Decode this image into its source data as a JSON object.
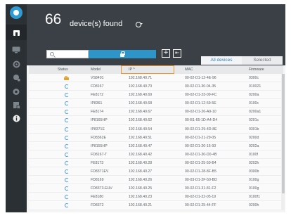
{
  "header": {
    "count": "66",
    "found_label": "device(s) found"
  },
  "toolbar": {
    "search_placeholder": "",
    "add_label": "+",
    "export_label": "⇤"
  },
  "tabs": {
    "all": "All devices",
    "selected": "Selected"
  },
  "columns": {
    "status": "Status",
    "model": "Model",
    "ip": "IP ^",
    "mac": "MAC",
    "firmware": "Firmware"
  },
  "rows": [
    {
      "status": "locked",
      "model": "VS8401",
      "ip": "192.168.40.71",
      "mac": "00-02-D1-12-4E-96",
      "firmware": "0300c"
    },
    {
      "status": "loading",
      "model": "FD8167",
      "ip": "192.168.40.70",
      "mac": "00-02-D1-30-04-35",
      "firmware": "010021"
    },
    {
      "status": "loading",
      "model": "FE8172",
      "ip": "192.168.40.69",
      "mac": "00-02-D1-23-09-FC",
      "firmware": "0200a"
    },
    {
      "status": "loading",
      "model": "IP8361",
      "ip": "192.168.40.68",
      "mac": "00-02-D1-12-59-5E",
      "firmware": "0100c"
    },
    {
      "status": "loading",
      "model": "FE8174",
      "ip": "192.168.40.67",
      "mac": "00-02-D1-26-A9-10",
      "firmware": "0200a1"
    },
    {
      "status": "loading",
      "model": "IP8165HP",
      "ip": "192.168.40.62",
      "mac": "00-B1-65-1D-A4-D4",
      "firmware": "0201c"
    },
    {
      "status": "loading",
      "model": "IP8371E",
      "ip": "192.168.40.54",
      "mac": "00-02-D1-29-4D-8E",
      "firmware": "0301b"
    },
    {
      "status": "loading",
      "model": "FD8362E",
      "ip": "192.168.40.51",
      "mac": "00-02-D1-21-29-05",
      "firmware": "0200d"
    },
    {
      "status": "loading",
      "model": "IP8155HP",
      "ip": "192.168.40.47",
      "mac": "00-02-D1-20-16-93",
      "firmware": "0202a"
    },
    {
      "status": "loading",
      "model": "FD8167-T",
      "ip": "192.168.40.42",
      "mac": "00-02-D1-30-D0-4B",
      "firmware": "0100f"
    },
    {
      "status": "loading",
      "model": "FE8173",
      "ip": "192.168.40.28",
      "mac": "00-02-D1-25-50-B4",
      "firmware": "0202h"
    },
    {
      "status": "loading",
      "model": "FD8371EV",
      "ip": "192.168.40.27",
      "mac": "00-02-D1-28-8F-B5",
      "firmware": "0300b"
    },
    {
      "status": "loading",
      "model": "FD8169",
      "ip": "192.168.40.26",
      "mac": "00-03-D1-2F-50-BD",
      "firmware": "0100g"
    },
    {
      "status": "loading",
      "model": "FD8373-EHV",
      "ip": "192.168.40.25",
      "mac": "00-02-D1-31-81-F2",
      "firmware": "0100g"
    },
    {
      "status": "loading",
      "model": "FE8180",
      "ip": "192.168.40.23",
      "mac": "00-02-D1-32-05-19",
      "firmware": "0100f1"
    },
    {
      "status": "loading",
      "model": "FD8372",
      "ip": "192.168.40.21",
      "mac": "00-02-D1-25-44-FF",
      "firmware": "0200h"
    }
  ],
  "colors": {
    "header_bg": "#3a4046",
    "sidebar_bg": "#2b3035",
    "accent": "#2e95c9",
    "highlight": "#f0962a",
    "lock": "#e2a32c"
  }
}
